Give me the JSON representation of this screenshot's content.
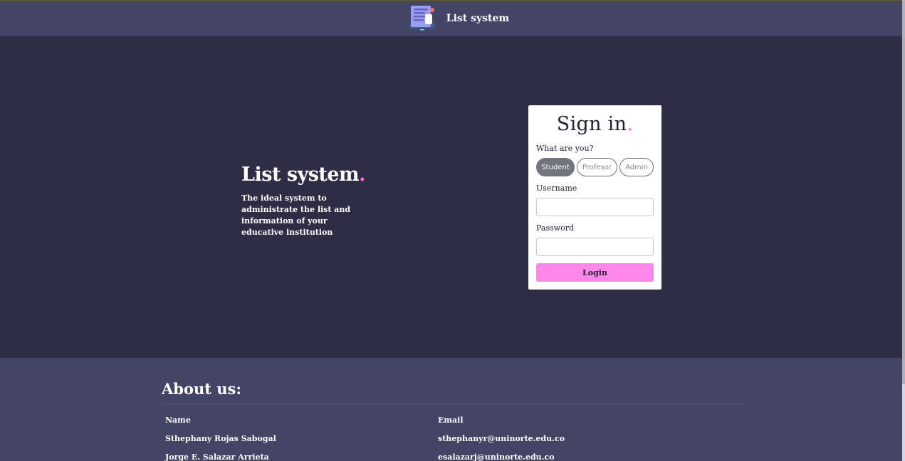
{
  "navbar": {
    "title": "List system",
    "logo_icon": "clipboard-list-icon"
  },
  "hero": {
    "title": "List system",
    "title_dot": ".",
    "description": "The ideal system to administrate the list and information of your educative institution"
  },
  "signin": {
    "title": "Sign in",
    "title_dot": ".",
    "role_label": "What are you?",
    "roles": [
      {
        "label": "Student",
        "selected": true
      },
      {
        "label": "Profesor",
        "selected": false
      },
      {
        "label": "Admin",
        "selected": false
      }
    ],
    "username_label": "Username",
    "username_value": "",
    "password_label": "Password",
    "password_value": "",
    "login_label": "Login"
  },
  "about": {
    "title": "About us:",
    "columns": [
      "Name",
      "Email"
    ],
    "rows": [
      [
        "Sthephany Rojas Sabogal",
        "sthephanyr@uninorte.edu.co"
      ],
      [
        "Jorge E. Salazar Arrieta",
        "esalazarj@uninorte.edu.co"
      ]
    ]
  },
  "colors": {
    "navbar_bg": "#444466",
    "hero_bg": "#2d2d45",
    "accent_pink": "#ff6ad5",
    "login_button": "#ff87ea",
    "selected_role": "#707580"
  }
}
